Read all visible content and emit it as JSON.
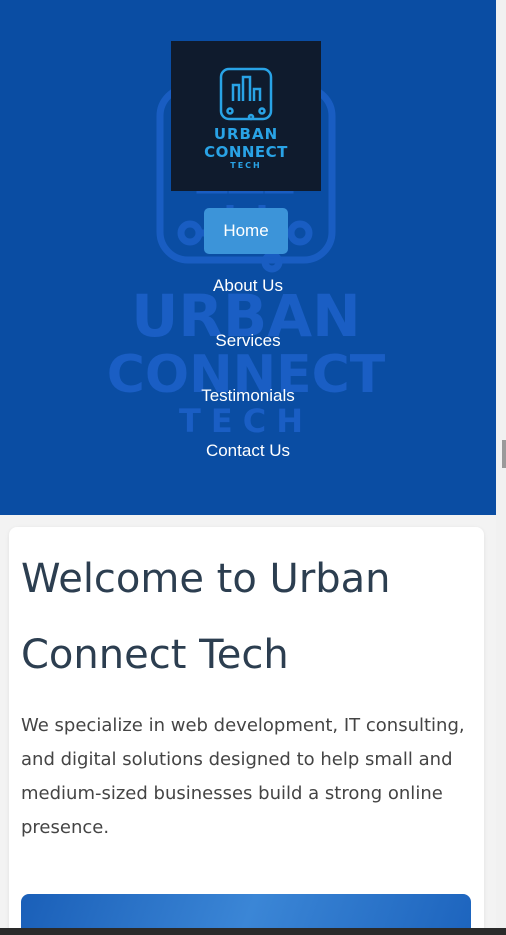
{
  "brand": {
    "logo_line1": "URBAN",
    "logo_line2": "CONNECT",
    "logo_line3": "TECH",
    "watermark_line1": "URBAN",
    "watermark_line2": "CONNECT",
    "watermark_line3": "TECH",
    "logo_icon": "city-circuit-icon"
  },
  "nav": {
    "items": [
      {
        "label": "Home",
        "active": true
      },
      {
        "label": "About Us",
        "active": false
      },
      {
        "label": "Services",
        "active": false
      },
      {
        "label": "Testimonials",
        "active": false
      },
      {
        "label": "Contact Us",
        "active": false
      }
    ]
  },
  "intro": {
    "heading": "Welcome to Urban Connect Tech",
    "body": "We specialize in web development, IT consulting, and digital solutions designed to help small and medium-sized businesses build a strong online presence."
  },
  "colors": {
    "hero_bg": "#0a4da3",
    "logo_bg": "#0f1b2d",
    "accent": "#29a3e6",
    "active_nav": "#3c94d9",
    "heading": "#2c3e50"
  }
}
